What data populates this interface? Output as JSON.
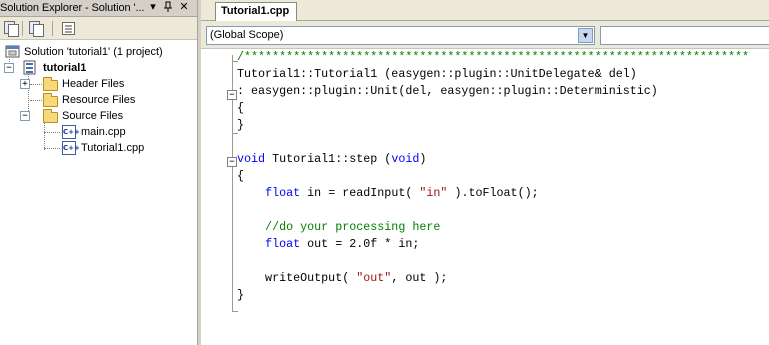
{
  "solution_explorer": {
    "title": "Solution Explorer - Solution '...",
    "dropdown_glyph": "▾",
    "pin_glyph": "ꟷ",
    "close_glyph": "✕",
    "tree": {
      "solution_label": "Solution 'tutorial1' (1 project)",
      "project_label": "tutorial1",
      "folders": [
        "Header Files",
        "Resource Files",
        "Source Files"
      ],
      "source_files": [
        "main.cpp",
        "Tutorial1.cpp"
      ],
      "file_icon_text": "C++"
    }
  },
  "editor": {
    "tab_label": "Tutorial1.cpp",
    "scope_value": "(Global Scope)",
    "scope_arrow": "▼",
    "member_value": "",
    "code_lines": [
      "/************************************************************************",
      "Tutorial1::Tutorial1 (easygen::plugin::UnitDelegate& del)",
      ": easygen::plugin::Unit(del, easygen::plugin::Deterministic)",
      "{",
      "}",
      "",
      "void Tutorial1::step (void)",
      "{",
      "    float in = readInput( \"in\" ).toFloat();",
      "",
      "    //do your processing here",
      "    float out = 2.0f * in;",
      "",
      "    writeOutput( \"out\", out );",
      "}"
    ]
  },
  "colors": {
    "keyword": "#0000ff",
    "comment": "#008000",
    "string": "#a31515",
    "chrome": "#ece9d8"
  }
}
